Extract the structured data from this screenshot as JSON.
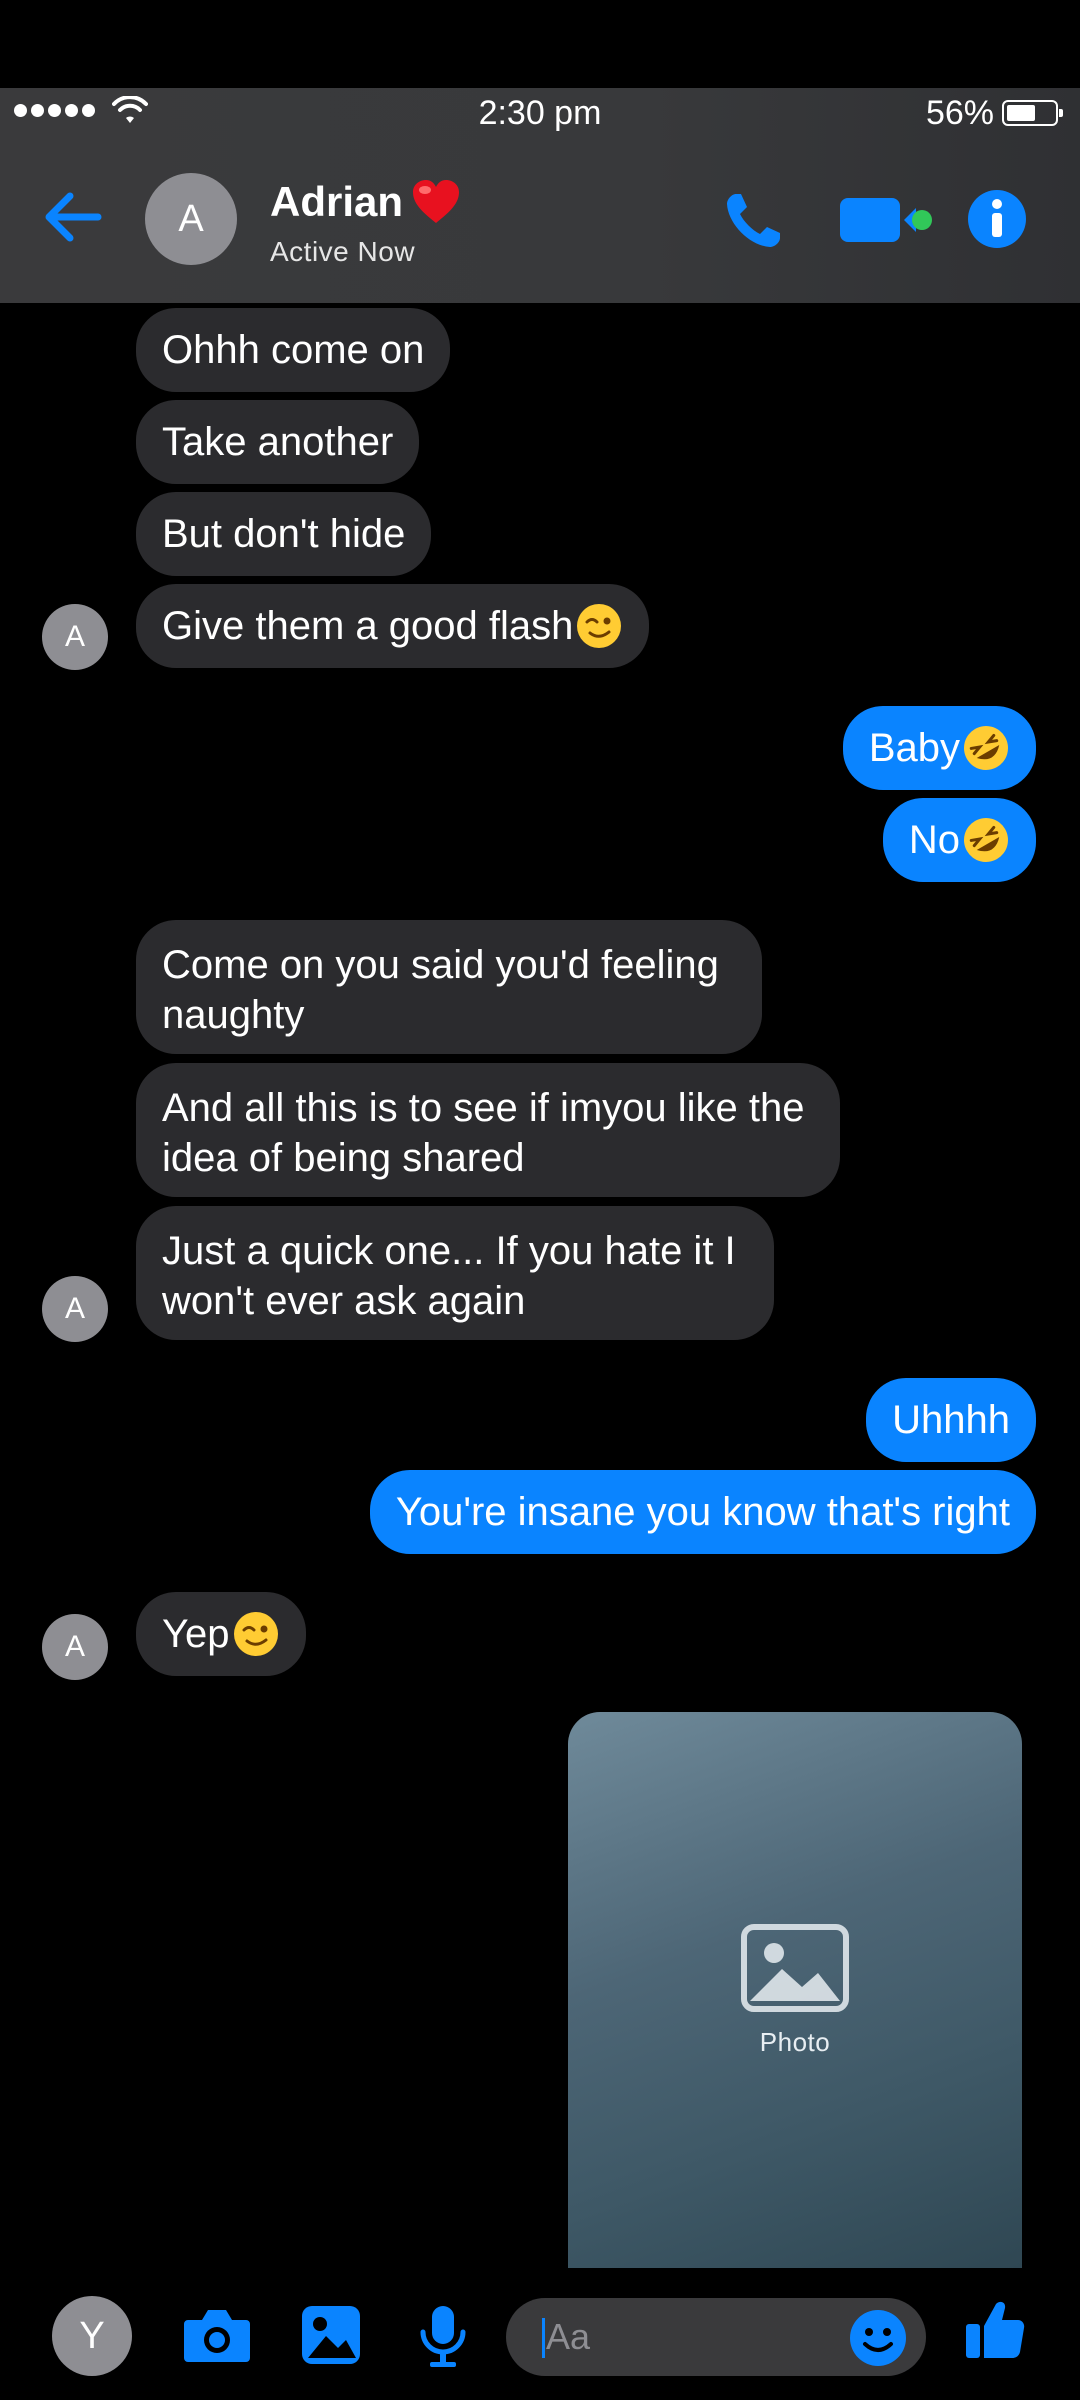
{
  "status_bar": {
    "time": "2:30 pm",
    "battery": "56%"
  },
  "header": {
    "avatar_initial": "A",
    "name": "Adrian",
    "name_emoji": "❤️",
    "presence": "Active Now",
    "icons": [
      "back-arrow-icon",
      "phone-icon",
      "video-icon",
      "info-icon"
    ],
    "accent": "#0a84ff"
  },
  "messages": [
    {
      "from": "them",
      "text": "Ohhh come on"
    },
    {
      "from": "them",
      "text": "Take another"
    },
    {
      "from": "them",
      "text": "But don't hide"
    },
    {
      "from": "them",
      "text": "Give them a good flash",
      "emoji": "wink"
    },
    {
      "from": "me",
      "text": "Baby",
      "emoji": "rofl"
    },
    {
      "from": "me",
      "text": "No",
      "emoji": "rofl"
    },
    {
      "from": "them",
      "text_lines": [
        "Come on you said you'd feeling",
        "naughty"
      ]
    },
    {
      "from": "them",
      "text_lines": [
        "And all this is to see if imyou like the",
        "idea of being shared"
      ]
    },
    {
      "from": "them",
      "text_lines": [
        "Just a quick one... If you hate it I",
        "won't ever ask again"
      ]
    },
    {
      "from": "me",
      "text": "Uhhhh"
    },
    {
      "from": "me",
      "text": "You're insane you know that's right"
    },
    {
      "from": "them",
      "text": "Yep",
      "emoji": "wink"
    },
    {
      "from": "me",
      "type": "photo"
    }
  ],
  "avatars": {
    "them": "A",
    "me": "Y"
  },
  "composer": {
    "placeholder": "Aa",
    "icons": [
      "camera-icon",
      "image-icon",
      "microphone-icon",
      "emoji-icon",
      "thumbs-up-icon"
    ]
  },
  "photo_note": "Photo"
}
